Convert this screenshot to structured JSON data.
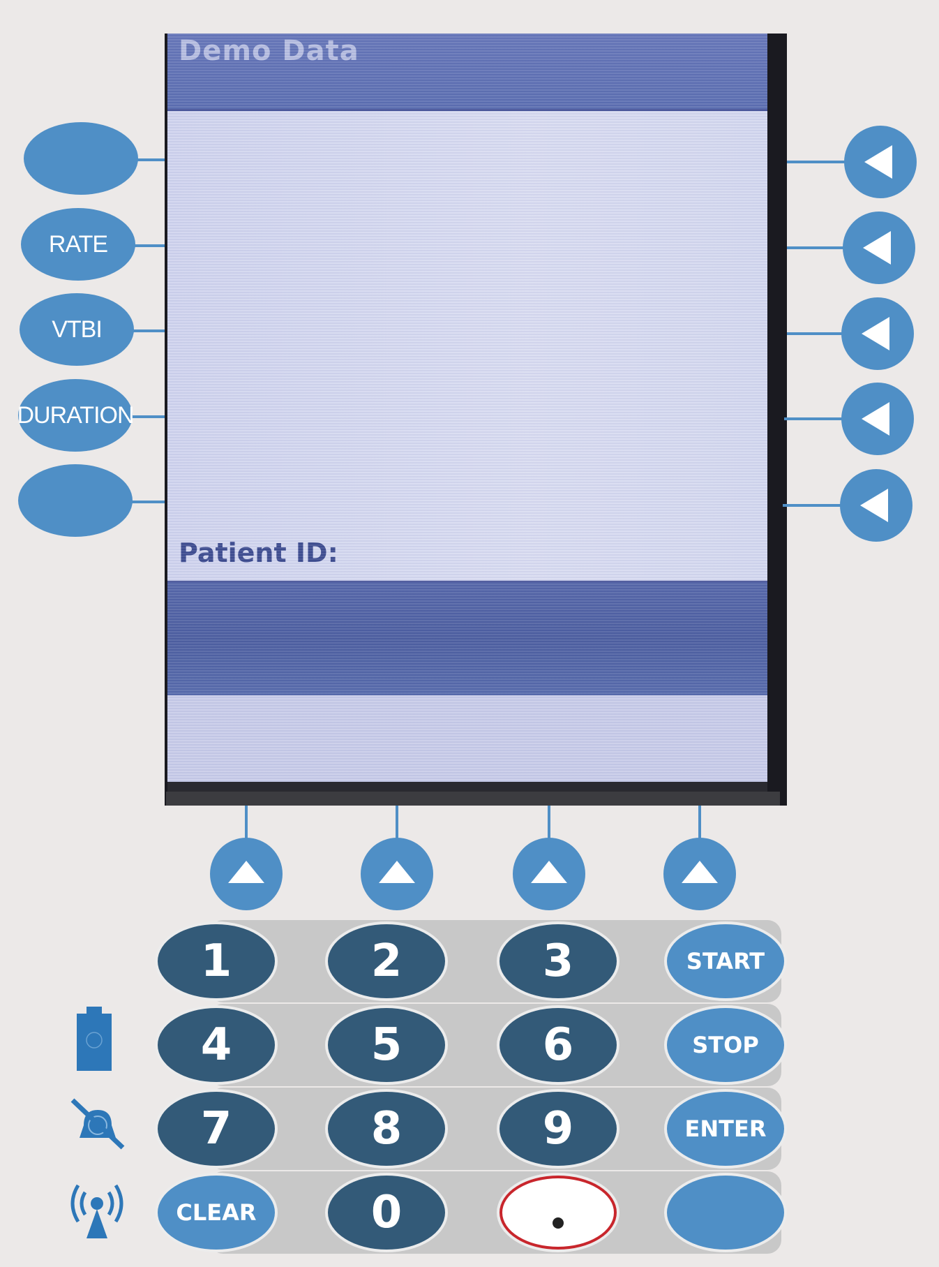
{
  "screen": {
    "title": "Demo Data",
    "patient_label": "Patient ID:"
  },
  "left_buttons": [
    {
      "label": ""
    },
    {
      "label": "RATE"
    },
    {
      "label": "VTBI"
    },
    {
      "label": "DURATION"
    },
    {
      "label": ""
    }
  ],
  "right_buttons": [
    {
      "icon": "triangle-left-icon"
    },
    {
      "icon": "triangle-left-icon"
    },
    {
      "icon": "triangle-left-icon"
    },
    {
      "icon": "triangle-left-icon"
    },
    {
      "icon": "triangle-left-icon"
    }
  ],
  "bottom_buttons": [
    {
      "icon": "triangle-up-icon"
    },
    {
      "icon": "triangle-up-icon"
    },
    {
      "icon": "triangle-up-icon"
    },
    {
      "icon": "triangle-up-icon"
    }
  ],
  "keypad": {
    "row1": [
      "1",
      "2",
      "3"
    ],
    "row2": [
      "4",
      "5",
      "6"
    ],
    "row3": [
      "7",
      "8",
      "9"
    ],
    "zero": "0",
    "clear": "CLEAR",
    "start": "START",
    "stop": "STOP",
    "enter": "ENTER",
    "blank": ""
  },
  "status_icons": [
    "battery-icon",
    "no-alarm-icon",
    "wireless-icon"
  ],
  "colors": {
    "button_blue": "#4f8fc6",
    "key_dark": "#335a78",
    "screen_title_bar": "#5a6db0",
    "screen_bg": "#d0d4ee",
    "decimal_ring": "#c8262c"
  }
}
